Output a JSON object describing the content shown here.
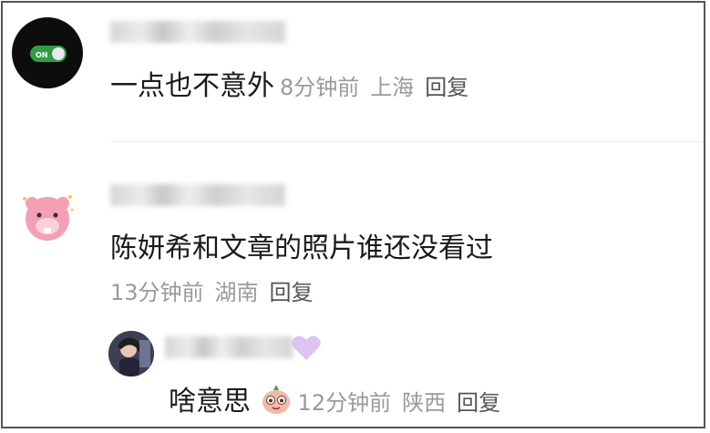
{
  "comments": [
    {
      "text": "一点也不意外",
      "time": "8分钟前",
      "location": "上海",
      "reply_label": "回复",
      "avatar": {
        "icon": "toggle-on-icon",
        "badge": "ON"
      }
    },
    {
      "text": "陈妍希和文章的照片谁还没看过",
      "time": "13分钟前",
      "location": "湖南",
      "reply_label": "回复",
      "avatar": {
        "icon": "pink-character-icon"
      },
      "replies": [
        {
          "text": "啥意思",
          "emoji": "smiling-face-emoji",
          "time": "12分钟前",
          "location": "陕西",
          "reply_label": "回复",
          "avatar": {
            "icon": "photo-avatar"
          }
        }
      ]
    }
  ]
}
